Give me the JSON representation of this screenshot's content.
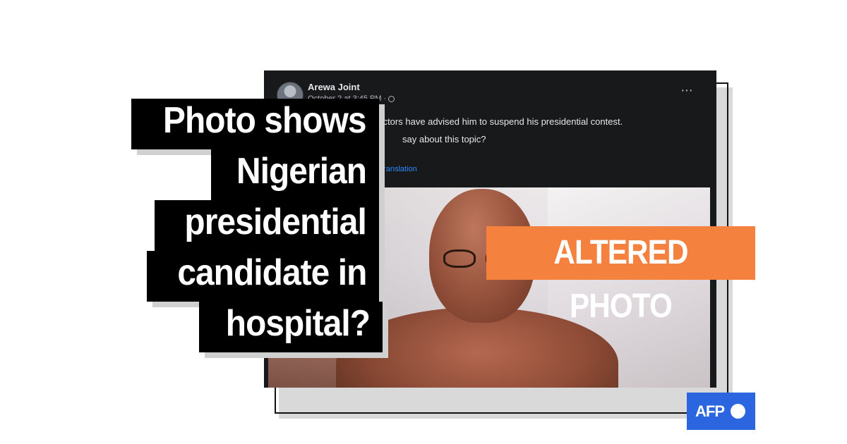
{
  "post": {
    "author": "Arewa Joint",
    "timestamp": "October 2 at 3:45 PM ·",
    "text_line1": "s doctors have advised him to suspend his presidential contest.",
    "text_line2": "say about this topic?",
    "translation_link": "translation",
    "more_icon": "···"
  },
  "headline": {
    "lines": [
      "Photo shows",
      "Nigerian",
      "presidential",
      "candidate in",
      "hospital?"
    ]
  },
  "badge": {
    "label": "ALTERED PHOTO"
  },
  "logo": {
    "label": "AFP"
  },
  "colors": {
    "badge": "#f5813f",
    "afp_blue": "#2b66e0",
    "post_bg": "#18191a",
    "link": "#2d88ff"
  }
}
